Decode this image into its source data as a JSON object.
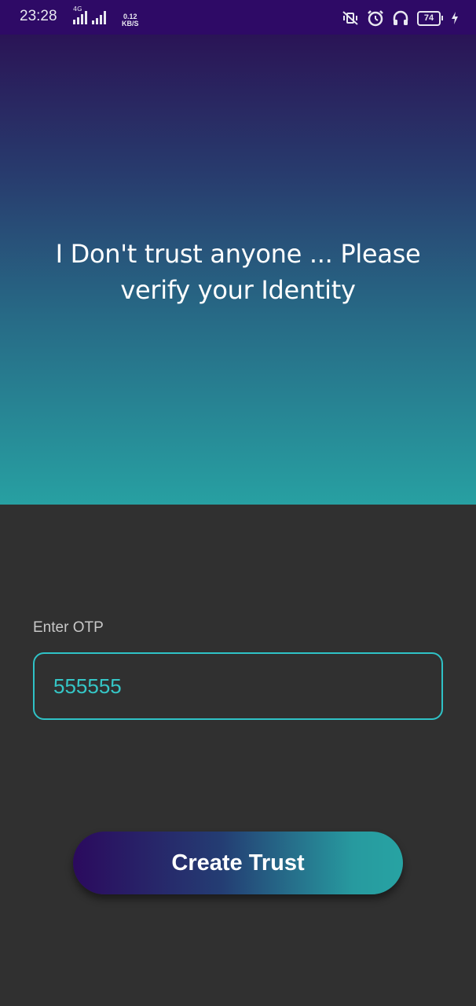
{
  "status_bar": {
    "time": "23:28",
    "network_type": "4G",
    "speed_value": "0.12",
    "speed_unit": "KB/S",
    "battery_level": "74",
    "icons": [
      "signal-icon",
      "signal-icon",
      "vibrate-off-icon",
      "alarm-icon",
      "headphones-icon",
      "battery-icon",
      "charging-icon"
    ]
  },
  "hero": {
    "title": "I Don't trust anyone ... Please verify your Identity",
    "gradient": [
      "#2a1456",
      "#27a0a2"
    ]
  },
  "form": {
    "otp_label": "Enter OTP",
    "otp_value": "555555"
  },
  "actions": {
    "create_trust_label": "Create Trust"
  },
  "colors": {
    "accent": "#2fc2c6",
    "background": "#303030",
    "status_bar": "#2e0a66"
  }
}
